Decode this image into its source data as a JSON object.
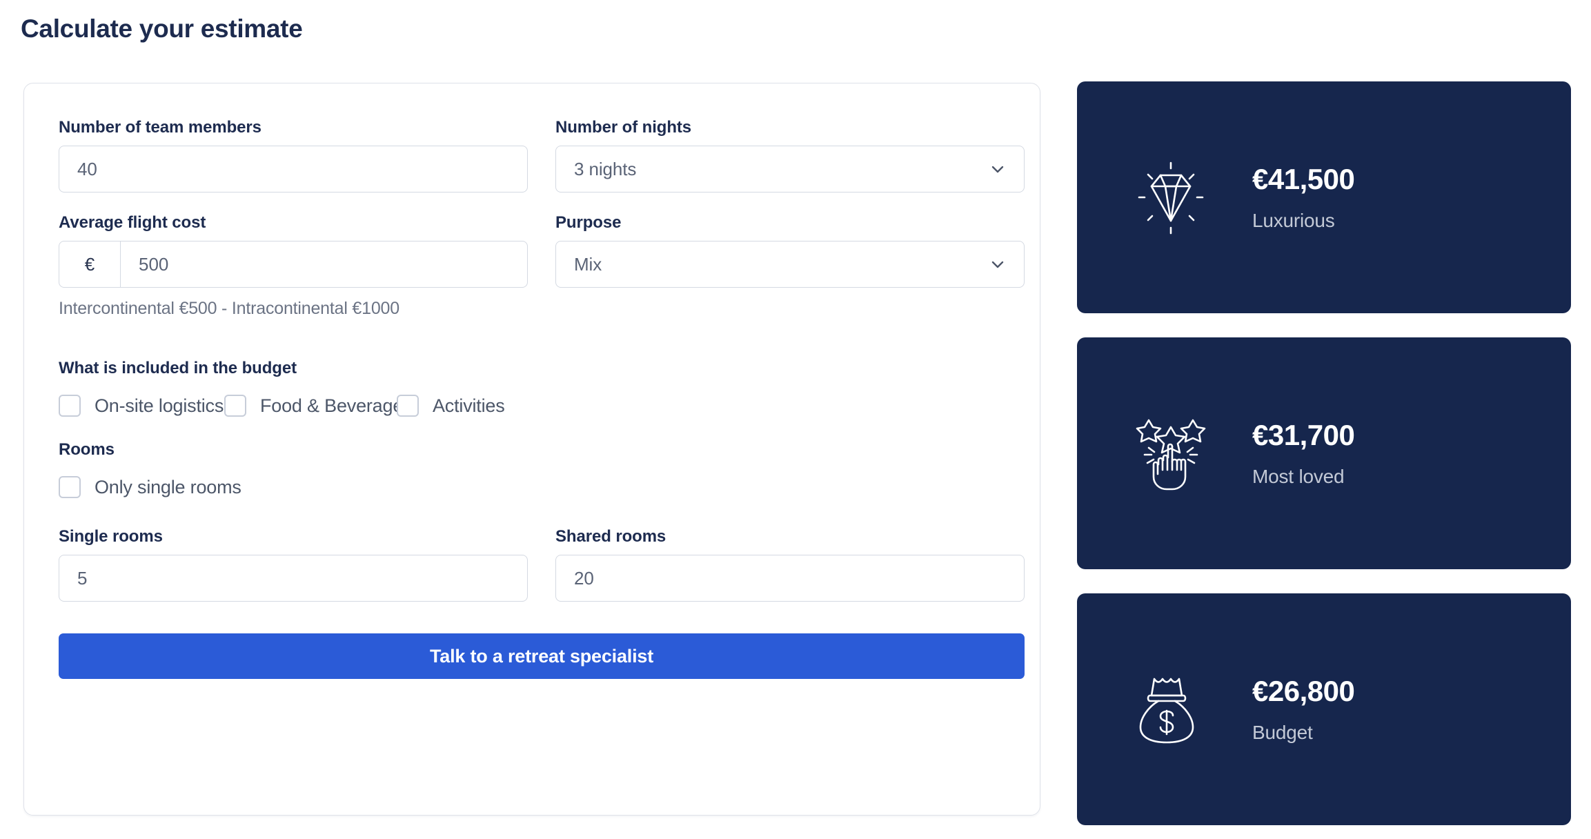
{
  "page": {
    "title": "Calculate your estimate"
  },
  "form": {
    "team_members": {
      "label": "Number of team members",
      "value": "40"
    },
    "nights": {
      "label": "Number of nights",
      "value": "3 nights",
      "icon": "chevron-down-icon"
    },
    "flight_cost": {
      "label": "Average flight cost",
      "currency_prefix": "€",
      "value": "500",
      "helper": "Intercontinental €500 - Intracontinental €1000"
    },
    "purpose": {
      "label": "Purpose",
      "value": "Mix",
      "icon": "chevron-down-icon"
    },
    "budget_section": {
      "title": "What is included in the budget",
      "options": [
        {
          "label": "On-site logistics",
          "checked": false
        },
        {
          "label": "Food & Beverage",
          "checked": false
        },
        {
          "label": "Activities",
          "checked": false
        }
      ]
    },
    "rooms_section": {
      "title": "Rooms",
      "options": [
        {
          "label": "Only single rooms",
          "checked": false
        }
      ]
    },
    "single_rooms": {
      "label": "Single rooms",
      "value": "5"
    },
    "shared_rooms": {
      "label": "Shared rooms",
      "value": "20"
    },
    "submit": {
      "label": "Talk to a retreat specialist"
    }
  },
  "results": {
    "cards": [
      {
        "amount": "€41,500",
        "tier": "Luxurious",
        "icon": "diamond-icon"
      },
      {
        "amount": "€31,700",
        "tier": "Most loved",
        "icon": "hand-pointing-stars-icon"
      },
      {
        "amount": "€26,800",
        "tier": "Budget",
        "icon": "money-bag-icon"
      }
    ]
  },
  "colors": {
    "heading": "#1d2b4f",
    "card_background": "#16264d",
    "accent_button": "#2b5bd7",
    "input_border": "#d4d9e2",
    "muted_text": "#6b7384"
  }
}
